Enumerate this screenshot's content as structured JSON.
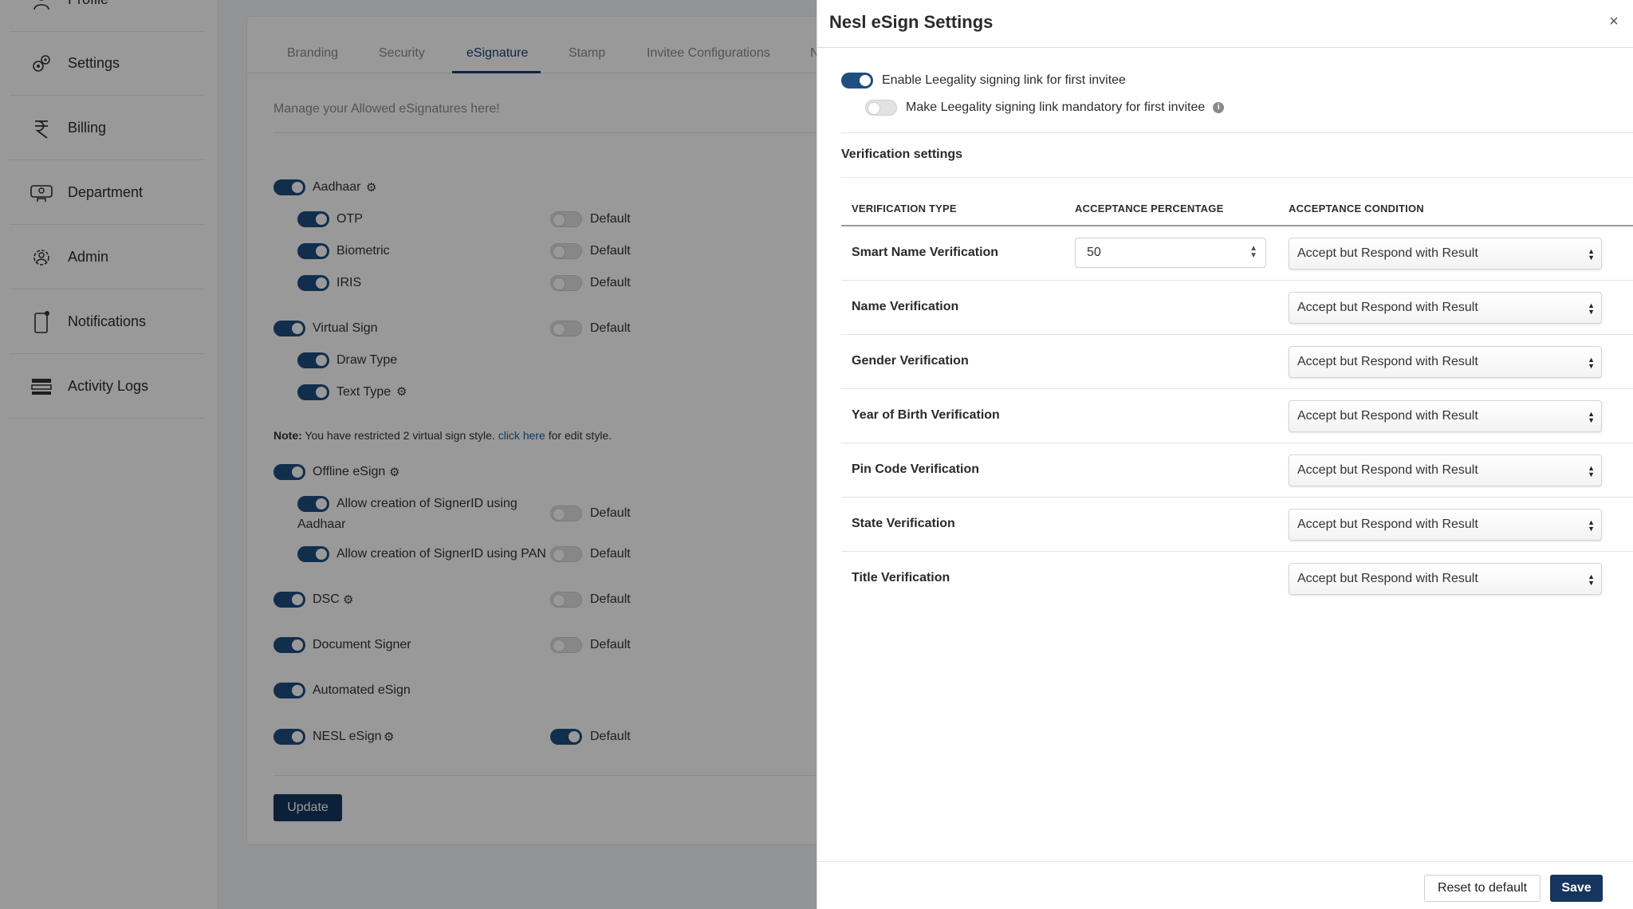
{
  "sidebar": {
    "items": [
      {
        "label": "Profile",
        "icon": "user-icon"
      },
      {
        "label": "Settings",
        "icon": "gears-icon"
      },
      {
        "label": "Billing",
        "icon": "rupee-icon"
      },
      {
        "label": "Department",
        "icon": "department-icon"
      },
      {
        "label": "Admin",
        "icon": "admin-gear-icon"
      },
      {
        "label": "Notifications",
        "icon": "phone-notification-icon"
      },
      {
        "label": "Activity Logs",
        "icon": "activity-list-icon"
      }
    ]
  },
  "tabs": [
    "Branding",
    "Security",
    "eSignature",
    "Stamp",
    "Invitee Configurations",
    "N"
  ],
  "esign_page": {
    "subtitle": "Manage your Allowed eSignatures here!",
    "default_label": "Default",
    "rows": {
      "aadhaar": "Aadhaar",
      "otp": "OTP",
      "biometric": "Biometric",
      "iris": "IRIS",
      "virtual_sign": "Virtual Sign",
      "draw_type": "Draw Type",
      "text_type": "Text Type",
      "offline_esign": "Offline eSign",
      "signer_aadhaar_1": "Allow creation of SignerID using",
      "signer_aadhaar_2": "Aadhaar",
      "signer_pan": "Allow creation of SignerID using PAN",
      "dsc": "DSC",
      "document_signer": "Document Signer",
      "automated_esign": "Automated eSign",
      "nesl_esign": "NESL eSign"
    },
    "note_label": "Note:",
    "note_text": " You have restricted 2 virtual sign style. ",
    "note_link": "click here",
    "note_suffix": " for edit style.",
    "update_label": "Update"
  },
  "drawer": {
    "title": "Nesl eSign Settings",
    "close_label": "×",
    "toggle_enable": "Enable Leegality signing link for first invitee",
    "toggle_mandatory": "Make Leegality signing link mandatory for first invitee",
    "section_title": "Verification settings",
    "columns": [
      "VERIFICATION TYPE",
      "ACCEPTANCE PERCENTAGE",
      "ACCEPTANCE CONDITION"
    ],
    "rows": [
      {
        "type": "Smart Name Verification",
        "percentage": "50",
        "condition": "Accept but Respond with Result"
      },
      {
        "type": "Name Verification",
        "condition": "Accept but Respond with Result"
      },
      {
        "type": "Gender Verification",
        "condition": "Accept but Respond with Result"
      },
      {
        "type": "Year of Birth Verification",
        "condition": "Accept but Respond with Result"
      },
      {
        "type": "Pin Code Verification",
        "condition": "Accept but Respond with Result"
      },
      {
        "type": "State Verification",
        "condition": "Accept but Respond with Result"
      },
      {
        "type": "Title Verification",
        "condition": "Accept but Respond with Result"
      }
    ],
    "reset_label": "Reset to default",
    "save_label": "Save"
  },
  "colors": {
    "primary": "#16365f",
    "toggle_on": "#1f4e80",
    "link": "#1f5fa8"
  }
}
